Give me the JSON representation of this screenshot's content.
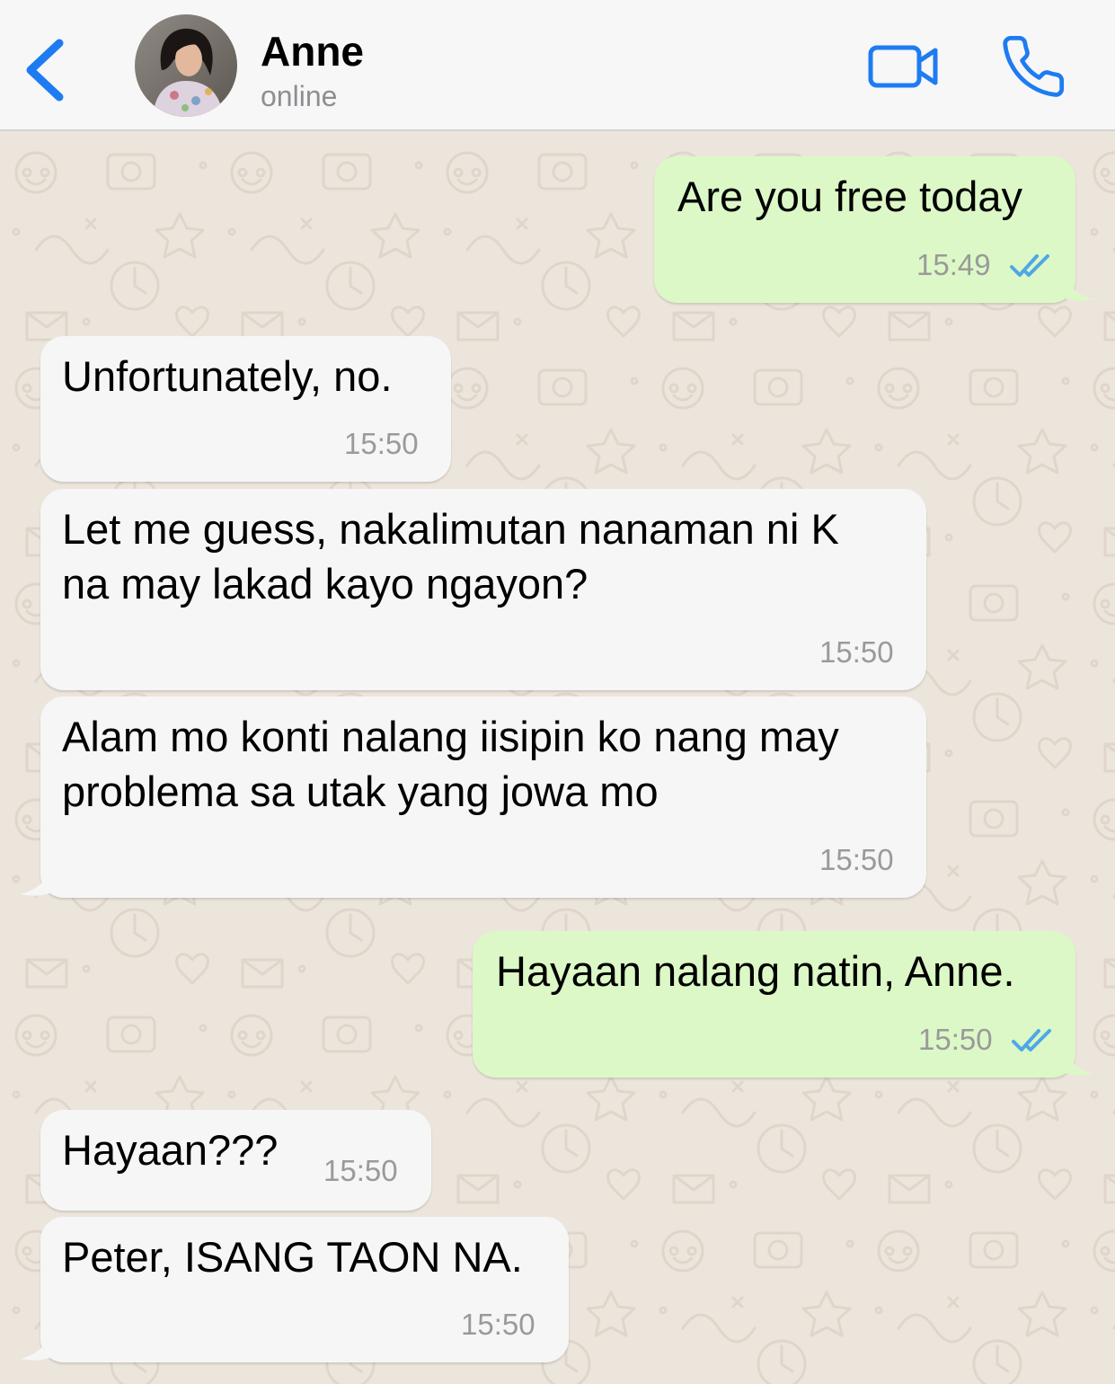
{
  "header": {
    "contact_name": "Anne",
    "status": "online",
    "back_icon": "chevron-left-icon",
    "video_icon": "video-camera-icon",
    "call_icon": "phone-icon",
    "accent_color": "#1e7cf2"
  },
  "chat": {
    "incoming_bubble_color": "#f6f6f6",
    "outgoing_bubble_color": "#dcf8c6",
    "read_receipt_color": "#4fa7e6",
    "messages": [
      {
        "direction": "outgoing",
        "lines": [
          "Are you free today"
        ],
        "time": "15:49",
        "read": true
      },
      {
        "direction": "incoming",
        "lines": [
          "Unfortunately, no."
        ],
        "time": "15:50"
      },
      {
        "direction": "incoming",
        "lines": [
          "Let me guess, nakalimutan nanaman ni K",
          "na may lakad kayo ngayon?"
        ],
        "time": "15:50"
      },
      {
        "direction": "incoming",
        "lines": [
          "Alam mo konti nalang iisipin ko nang may",
          "problema sa utak yang jowa mo"
        ],
        "time": "15:50"
      },
      {
        "direction": "outgoing",
        "lines": [
          "Hayaan nalang natin, Anne."
        ],
        "time": "15:50",
        "read": true
      },
      {
        "direction": "incoming",
        "lines": [
          "Hayaan???"
        ],
        "time": "15:50"
      },
      {
        "direction": "incoming",
        "lines": [
          "Peter, ISANG TAON NA."
        ],
        "time": "15:50"
      }
    ]
  }
}
